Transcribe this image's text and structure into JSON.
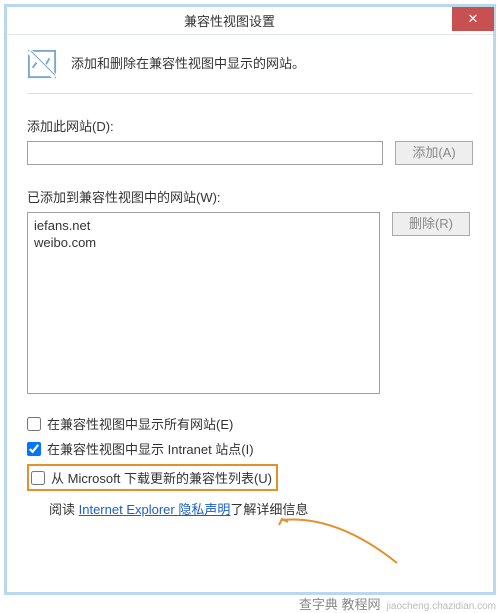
{
  "window": {
    "title": "兼容性视图设置"
  },
  "intro": {
    "text": "添加和删除在兼容性视图中显示的网站。"
  },
  "add_section": {
    "label": "添加此网站(D):",
    "input_value": "",
    "button": "添加(A)"
  },
  "list_section": {
    "label": "已添加到兼容性视图中的网站(W):",
    "items": [
      "iefans.net",
      "weibo.com"
    ],
    "remove_button": "删除(R)"
  },
  "checkboxes": {
    "show_all": {
      "label": "在兼容性视图中显示所有网站(E)",
      "checked": false
    },
    "show_intranet": {
      "label": "在兼容性视图中显示 Intranet 站点(I)",
      "checked": true
    },
    "download_updates": {
      "label": "从 Microsoft 下载更新的兼容性列表(U)",
      "checked": false
    }
  },
  "reading": {
    "prefix": "阅读 ",
    "link": "Internet Explorer 隐私声明",
    "suffix": "了解详细信息"
  },
  "watermark": {
    "cn": "查字典",
    "suffix": "教程网",
    "en": "jiaocheng.chazidian.com"
  }
}
